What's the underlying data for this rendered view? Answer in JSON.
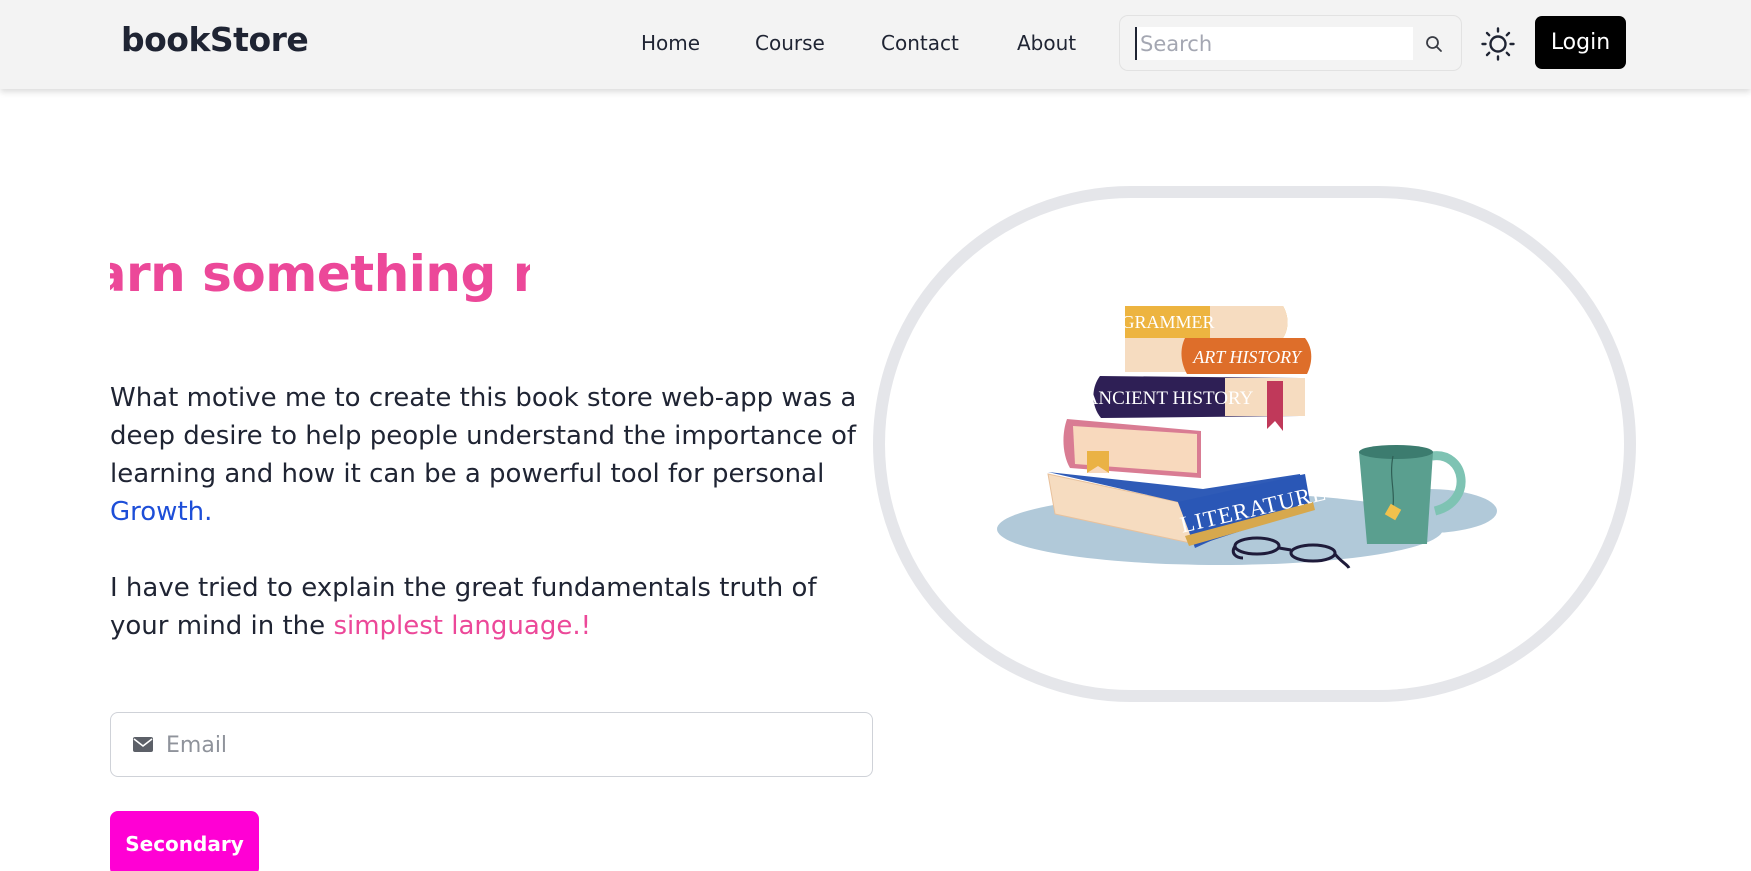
{
  "navbar": {
    "brand": "bookStore",
    "links": [
      {
        "label": "Home"
      },
      {
        "label": "Course"
      },
      {
        "label": "Contact"
      },
      {
        "label": "About"
      }
    ],
    "search": {
      "placeholder": "Search",
      "value": ""
    },
    "login_label": "Login"
  },
  "hero": {
    "heading": "Learn something new everyday!!!",
    "para1": {
      "text": "What motive me to create this book store web-app was a deep desire to help people understand the importance of learning and how it can be a powerful tool for personal ",
      "highlight": "Growth."
    },
    "para2": {
      "text": "I have tried to explain the great fundamentals truth of your mind in the ",
      "highlight": "simplest language.!"
    },
    "email": {
      "placeholder": "Email",
      "value": ""
    },
    "button_label": "Secondary"
  },
  "illustration": {
    "books": [
      "GRAMMER",
      "ART HISTORY",
      "ANCIENT HISTORY",
      "LITERATURE"
    ]
  },
  "colors": {
    "accent_pink": "#ec4899",
    "accent_blue": "#1d4ed8",
    "button_magenta": "#ff00d4",
    "navbar_bg": "#f3f3f3",
    "login_bg": "#000000"
  },
  "icons": [
    "search-icon",
    "sun-icon",
    "mail-icon"
  ]
}
